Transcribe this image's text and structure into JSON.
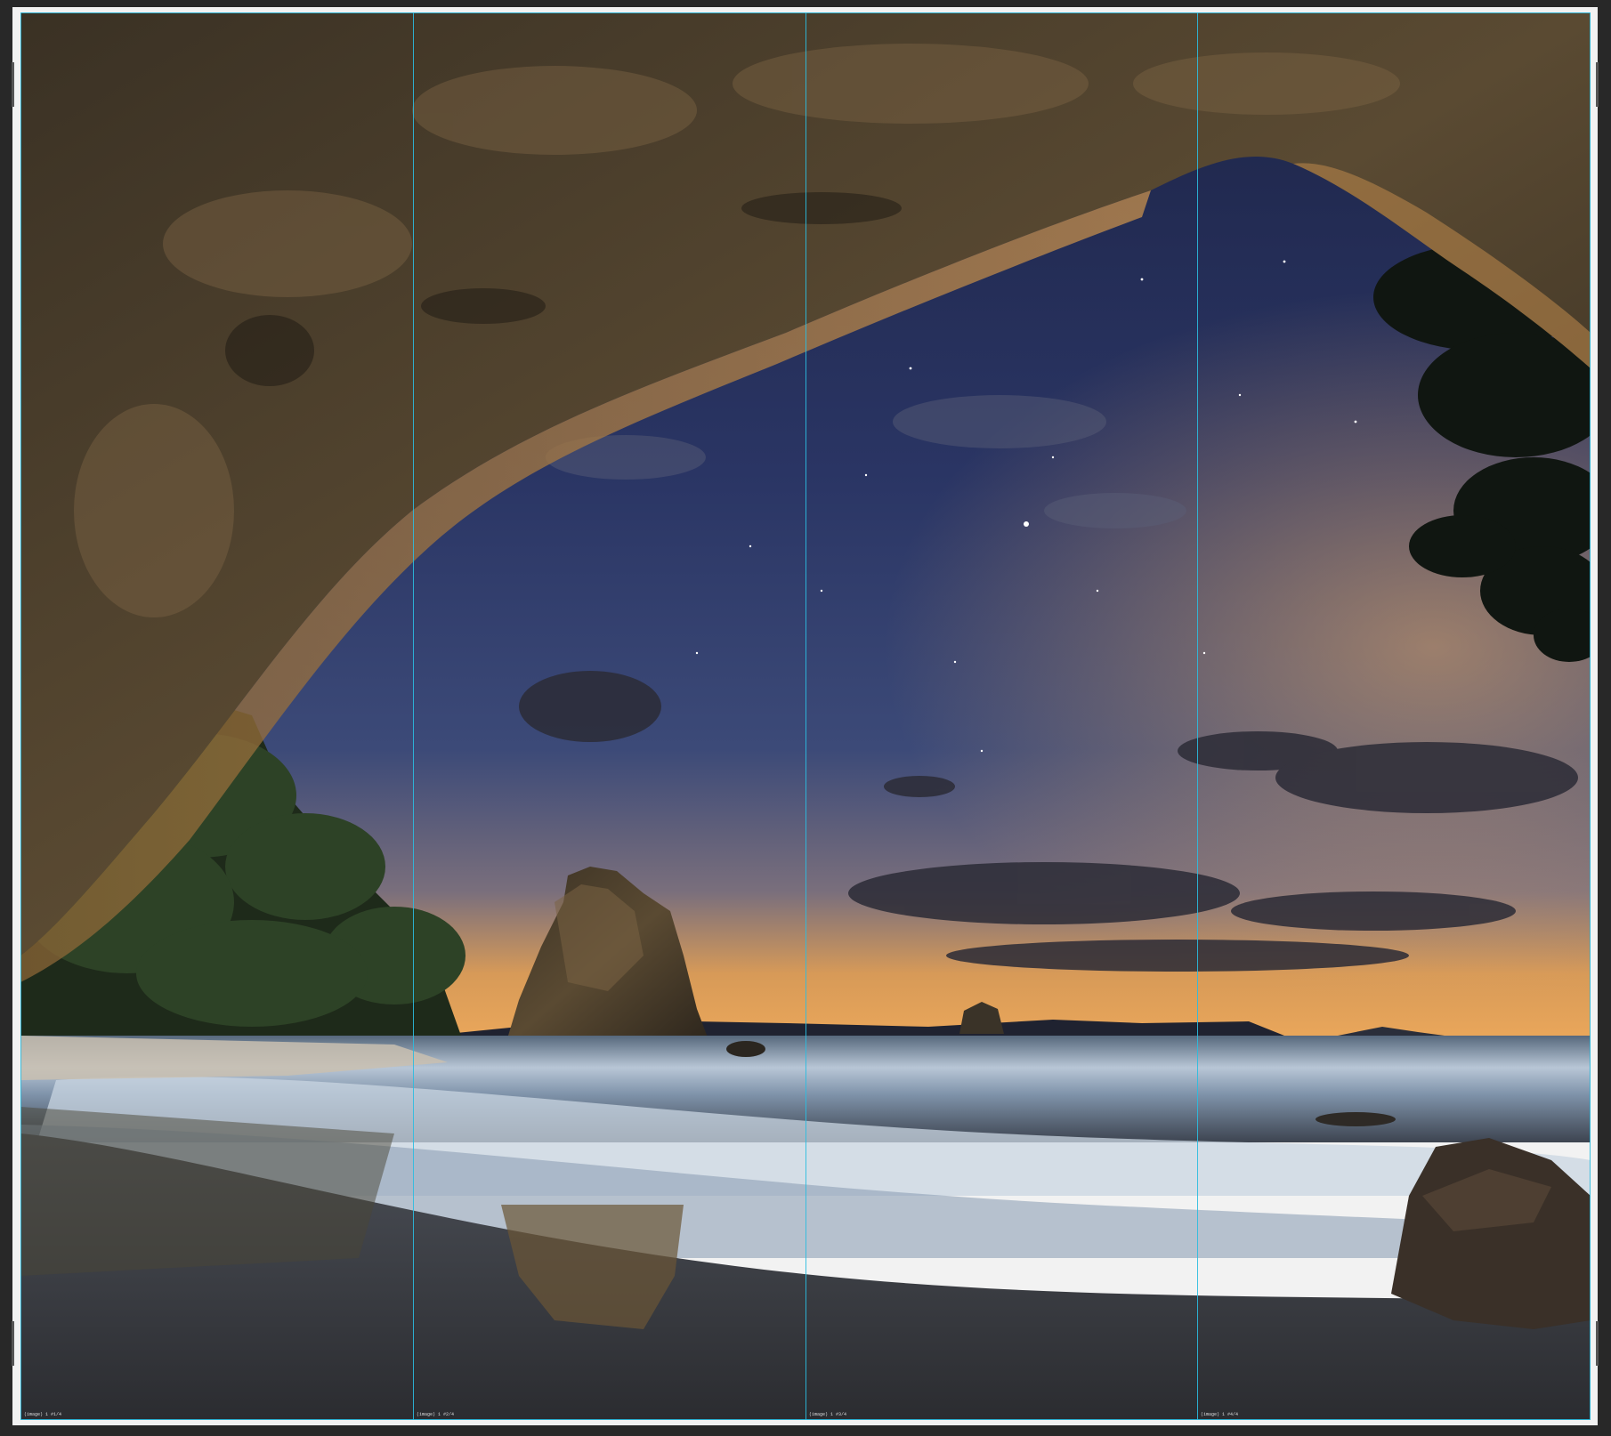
{
  "document": {
    "panel_labels": [
      "(image) 1 #1/4",
      "(image) 1 #2/4",
      "(image) 1 #3/4",
      "(image) 1 #4/4"
    ]
  },
  "colors": {
    "canvas_background": "#282828",
    "guide_line": "#2bbde0",
    "page_frame": "#f2f2f2"
  }
}
